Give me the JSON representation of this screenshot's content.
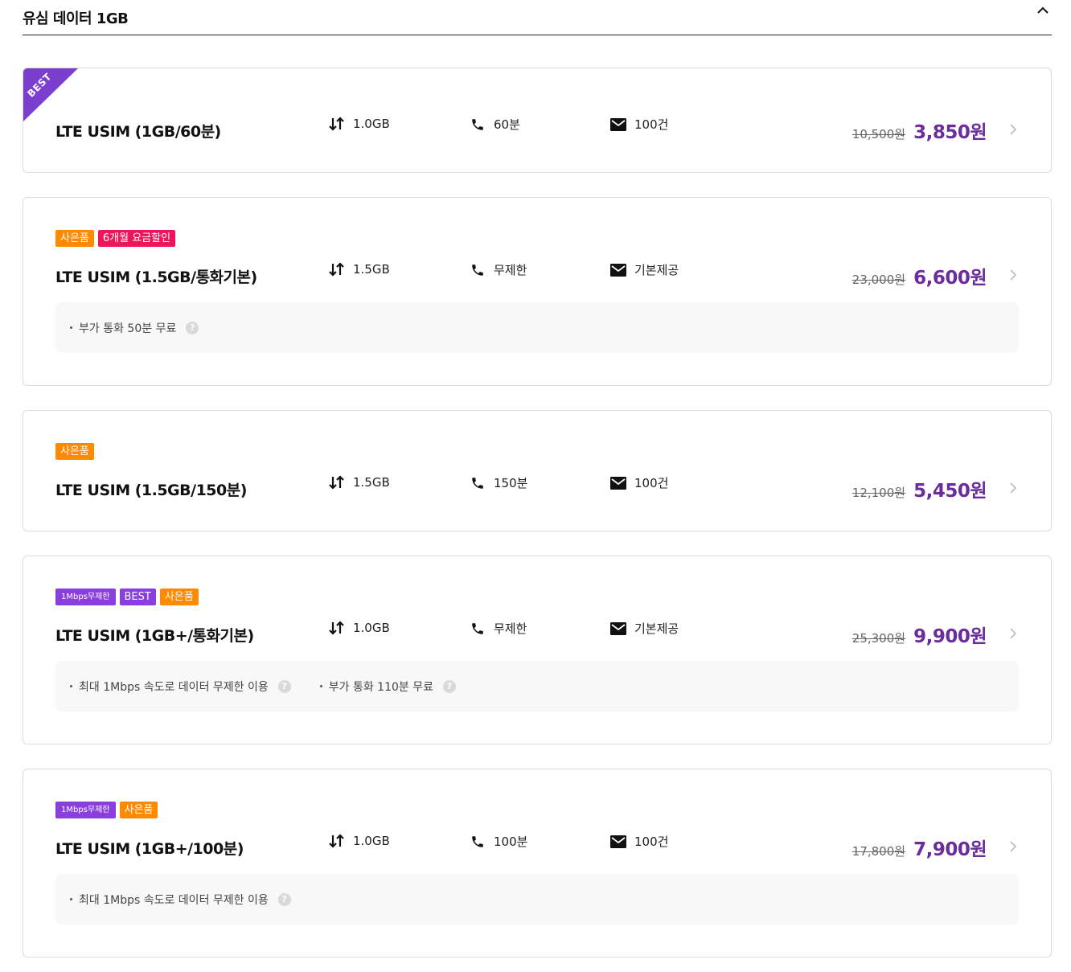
{
  "section": {
    "title": "유심 데이터 1GB",
    "collapse_icon": "chevron-up-icon"
  },
  "ribbon_label": "BEST",
  "plans": [
    {
      "name": "LTE USIM (1GB/60분)",
      "data": "1.0GB",
      "voice": "60분",
      "sms": "100건",
      "original_price": "10,500원",
      "price": "3,850원",
      "badges": [],
      "benefits": []
    },
    {
      "name": "LTE USIM (1.5GB/통화기본)",
      "data": "1.5GB",
      "voice": "무제한",
      "sms": "기본제공",
      "original_price": "23,000원",
      "price": "6,600원",
      "badges": [
        "사은품",
        "6개월 요금할인"
      ],
      "benefits": [
        "부가 통화 50분 무료"
      ]
    },
    {
      "name": "LTE USIM (1.5GB/150분)",
      "data": "1.5GB",
      "voice": "150분",
      "sms": "100건",
      "original_price": "12,100원",
      "price": "5,450원",
      "badges": [
        "사은품"
      ],
      "benefits": []
    },
    {
      "name": "LTE USIM (1GB+/통화기본)",
      "data": "1.0GB",
      "voice": "무제한",
      "sms": "기본제공",
      "original_price": "25,300원",
      "price": "9,900원",
      "badges": [
        "1Mbps무제한",
        "BEST",
        "사은품"
      ],
      "benefits": [
        "최대 1Mbps 속도로 데이터 무제한 이용",
        "부가 통화 110분 무료"
      ]
    },
    {
      "name": "LTE USIM (1GB+/100분)",
      "data": "1.0GB",
      "voice": "100분",
      "sms": "100건",
      "original_price": "17,800원",
      "price": "7,900원",
      "badges": [
        "1Mbps무제한",
        "사은품"
      ],
      "benefits": [
        "최대 1Mbps 속도로 데이터 무제한 이용"
      ]
    }
  ],
  "colors": {
    "accent_price": "#6b2d9b",
    "badge_orange": "#ff8a00",
    "badge_pink": "#f0145a",
    "badge_purple": "#8a3ee0"
  },
  "icons": {
    "data": "data-transfer-arrows-icon",
    "voice": "phone-icon",
    "sms": "envelope-icon",
    "help": "question-icon",
    "detail": "chevron-right-icon"
  }
}
